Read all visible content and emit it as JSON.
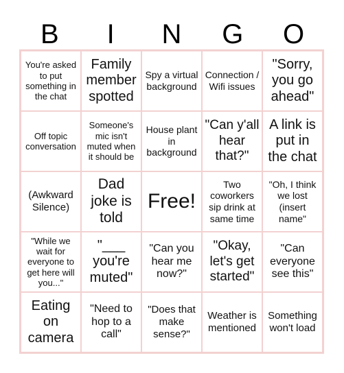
{
  "header": {
    "letters": [
      "B",
      "I",
      "N",
      "G",
      "O"
    ]
  },
  "colors": {
    "grid_border": "#f3d1d1",
    "text": "#111111",
    "background": "#ffffff"
  },
  "cells": [
    [
      "You're asked to put something in the chat",
      "Family member spotted",
      "Spy a virtual background",
      "Connection / Wifi issues",
      "\"Sorry, you go ahead\""
    ],
    [
      "Off topic conversation",
      "Someone's mic isn't muted when it should be",
      "House plant in background",
      "\"Can y'all hear that?\"",
      "A link is put in the chat"
    ],
    [
      "(Awkward Silence)",
      "Dad joke is told",
      "Free!",
      "Two coworkers sip drink at same time",
      "\"Oh, I think we lost (insert name\""
    ],
    [
      "\"While we wait for everyone to get here will you...\"",
      "\"___ you're muted\"",
      "\"Can you hear me now?\"",
      "\"Okay, let's get started\"",
      "\"Can everyone see this\""
    ],
    [
      "Eating on camera",
      "\"Need to hop to a call\"",
      "\"Does that make sense?\"",
      "Weather is mentioned",
      "Something won't load"
    ]
  ]
}
